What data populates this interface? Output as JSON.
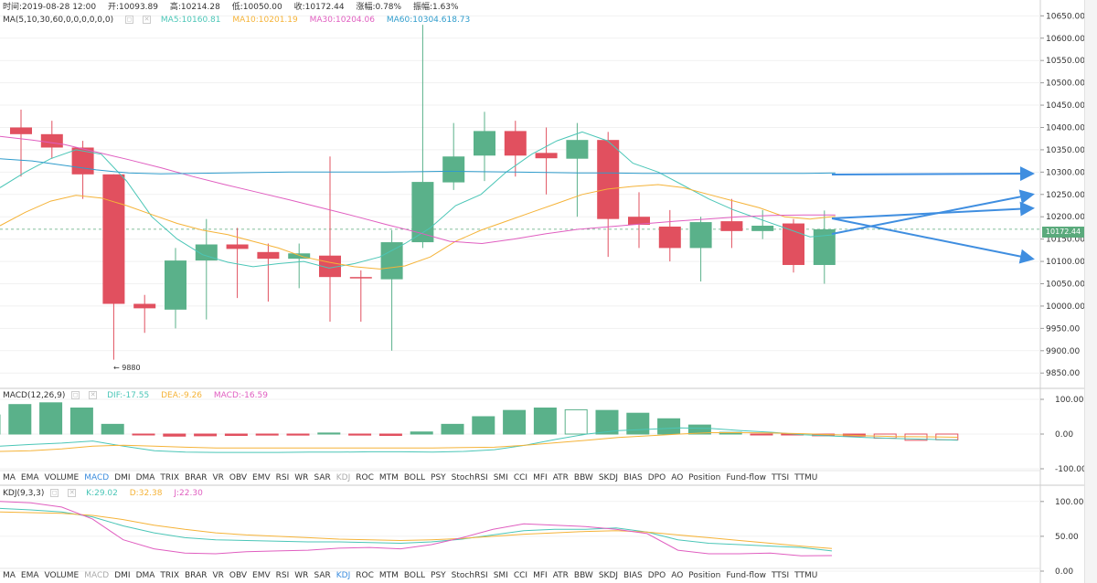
{
  "header": {
    "time_label": "时间:2019-08-28 12:00",
    "open_label": "开:10093.89",
    "high_label": "高:10214.28",
    "low_label": "低:10050.00",
    "close_label": "收:10172.44",
    "change_label": "涨幅:0.78%",
    "amplitude_label": "振幅:1.63%"
  },
  "ma_legend": {
    "title": "MA(5,10,30,60,0,0,0,0,0,0)",
    "ma5": "MA5:10160.81",
    "ma10": "MA10:10201.19",
    "ma30": "MA30:10204.06",
    "ma60": "MA60:10304.",
    "ma60_tail": "618.73"
  },
  "colors": {
    "up": "#5ab18a",
    "down": "#e1505f",
    "ma5": "#4bc6b7",
    "ma10": "#f5b338",
    "ma30": "#e05ec0",
    "ma60": "#2f9ccc",
    "arrow": "#3f8ee0",
    "dif": "#4bc6b7",
    "dea": "#f5b338",
    "macd": "#e05ec0",
    "tab_active": "#3c8dde"
  },
  "price_tag": "10172.44",
  "low_marker": "← 9880",
  "macd_legend": {
    "title": "MACD(12,26,9)",
    "dif": "DIF:-17.55",
    "dea": "DEA:-9.26",
    "macd": "MACD:-16.59"
  },
  "kdj_legend": {
    "title": "KDJ(9,3,3)",
    "k": "K:29.02",
    "d": "D:32.38",
    "j": "J:22.30"
  },
  "indicator_tabs": [
    "MA",
    "EMA",
    "VOLUME",
    "MACD",
    "DMI",
    "DMA",
    "TRIX",
    "BRAR",
    "VR",
    "OBV",
    "EMV",
    "RSI",
    "WR",
    "SAR",
    "KDJ",
    "ROC",
    "MTM",
    "BOLL",
    "PSY",
    "StochRSI",
    "SMI",
    "CCI",
    "MFI",
    "ATR",
    "BBW",
    "SKDJ",
    "BIAS",
    "DPO",
    "AO",
    "Position",
    "Fund-flow",
    "TTSI",
    "TTMU"
  ],
  "chart_data": [
    {
      "type": "candlestick",
      "name": "main",
      "y_ticks": [
        "10650.00",
        "10600.00",
        "10550.00",
        "10500.00",
        "10450.00",
        "10400.00",
        "10350.00",
        "10300.00",
        "10250.00",
        "10200.00",
        "10150.00",
        "10100.00",
        "10050.00",
        "10000.00",
        "9950.00",
        "9900.00",
        "9850.00"
      ],
      "ylim": [
        9830,
        10665
      ],
      "candles": [
        {
          "o": 10400,
          "h": 10440,
          "l": 10290,
          "c": 10385
        },
        {
          "o": 10385,
          "h": 10415,
          "l": 10330,
          "c": 10355
        },
        {
          "o": 10355,
          "h": 10370,
          "l": 10240,
          "c": 10295
        },
        {
          "o": 10295,
          "h": 10295,
          "l": 9880,
          "c": 10005
        },
        {
          "o": 10005,
          "h": 10025,
          "l": 9940,
          "c": 9995
        },
        {
          "o": 9992,
          "h": 10130,
          "l": 9950,
          "c": 10102
        },
        {
          "o": 10102,
          "h": 10195,
          "l": 9970,
          "c": 10138
        },
        {
          "o": 10138,
          "h": 10175,
          "l": 10018,
          "c": 10128
        },
        {
          "o": 10121,
          "h": 10140,
          "l": 10010,
          "c": 10106
        },
        {
          "o": 10106,
          "h": 10140,
          "l": 10040,
          "c": 10118
        },
        {
          "o": 10113,
          "h": 10335,
          "l": 9965,
          "c": 10065
        },
        {
          "o": 10065,
          "h": 10080,
          "l": 9965,
          "c": 10062
        },
        {
          "o": 10060,
          "h": 10170,
          "l": 9900,
          "c": 10143
        },
        {
          "o": 10143,
          "h": 10630,
          "l": 10130,
          "c": 10278
        },
        {
          "o": 10277,
          "h": 10410,
          "l": 10260,
          "c": 10335
        },
        {
          "o": 10337,
          "h": 10435,
          "l": 10280,
          "c": 10392
        },
        {
          "o": 10392,
          "h": 10415,
          "l": 10290,
          "c": 10337
        },
        {
          "o": 10343,
          "h": 10400,
          "l": 10250,
          "c": 10331
        },
        {
          "o": 10330,
          "h": 10410,
          "l": 10200,
          "c": 10372
        },
        {
          "o": 10372,
          "h": 10390,
          "l": 10110,
          "c": 10195
        },
        {
          "o": 10200,
          "h": 10255,
          "l": 10130,
          "c": 10182
        },
        {
          "o": 10178,
          "h": 10215,
          "l": 10100,
          "c": 10130
        },
        {
          "o": 10130,
          "h": 10200,
          "l": 10055,
          "c": 10188
        },
        {
          "o": 10190,
          "h": 10240,
          "l": 10130,
          "c": 10168
        },
        {
          "o": 10168,
          "h": 10215,
          "l": 10150,
          "c": 10180
        },
        {
          "o": 10185,
          "h": 10195,
          "l": 10075,
          "c": 10092
        },
        {
          "o": 10092,
          "h": 10214,
          "l": 10050,
          "c": 10172
        }
      ],
      "ma_series": [
        {
          "name": "MA5",
          "values": [
            10265,
            10300,
            10330,
            10350,
            10340,
            10280,
            10200,
            10150,
            10115,
            10098,
            10088,
            10095,
            10100,
            10085,
            10095,
            10110,
            10140,
            10175,
            10225,
            10250,
            10300,
            10340,
            10370,
            10390,
            10370,
            10320,
            10300,
            10270,
            10240,
            10215,
            10195,
            10175,
            10155,
            10160
          ]
        },
        {
          "name": "MA10",
          "values": [
            10180,
            10210,
            10235,
            10248,
            10242,
            10225,
            10205,
            10185,
            10170,
            10160,
            10145,
            10130,
            10110,
            10098,
            10088,
            10083,
            10090,
            10110,
            10145,
            10170,
            10190,
            10210,
            10230,
            10250,
            10262,
            10268,
            10272,
            10265,
            10250,
            10235,
            10220,
            10200,
            10195,
            10201
          ]
        },
        {
          "name": "MA30",
          "values": [
            10380,
            10372,
            10362,
            10345,
            10328,
            10310,
            10290,
            10272,
            10255,
            10238,
            10220,
            10202,
            10183,
            10165,
            10145,
            10140,
            10150,
            10162,
            10172,
            10178,
            10184,
            10190,
            10195,
            10200,
            10203,
            10204,
            10204
          ]
        },
        {
          "name": "MA60",
          "values": [
            10330,
            10325,
            10315,
            10305,
            10298,
            10296,
            10297,
            10298,
            10299,
            10300,
            10300,
            10300,
            10300,
            10301,
            10302,
            10301,
            10300,
            10299,
            10298,
            10298,
            10297,
            10297,
            10297,
            10297,
            10297,
            10297,
            10298
          ]
        }
      ]
    },
    {
      "type": "bar",
      "name": "MACD",
      "y_ticks": [
        "100.00",
        "0.00",
        "-100.00"
      ],
      "ylim": [
        -100,
        100
      ],
      "histogram": [
        55,
        85,
        90,
        75,
        28,
        -2,
        -6,
        -5,
        -4,
        -3,
        -3,
        3,
        -3,
        -4,
        6,
        28,
        50,
        68,
        75,
        70,
        68,
        60,
        44,
        26,
        5,
        -1,
        -2,
        -5,
        -6,
        -12,
        -18,
        -16.59
      ],
      "dif": [
        -35,
        -30,
        -26,
        -20,
        -35,
        -48,
        -52,
        -53,
        -53,
        -53,
        -52,
        -52,
        -51,
        -51,
        -52,
        -50,
        -45,
        -32,
        -15,
        0,
        10,
        14,
        18,
        16,
        10,
        5,
        -2,
        -6,
        -10,
        -13,
        -15,
        -17.55
      ],
      "dea": [
        -50,
        -48,
        -43,
        -35,
        -32,
        -35,
        -38,
        -40,
        -40,
        -40,
        -40,
        -40,
        -40,
        -40,
        -40,
        -39,
        -38,
        -32,
        -25,
        -18,
        -10,
        -5,
        0,
        4,
        4,
        3,
        1,
        -2,
        -5,
        -7,
        -8,
        -9.26
      ]
    },
    {
      "type": "line",
      "name": "KDJ",
      "y_ticks": [
        "100.00",
        "50.00",
        "0.00"
      ],
      "ylim": [
        0,
        105
      ],
      "k": [
        90,
        88,
        85,
        78,
        65,
        55,
        48,
        45,
        44,
        43,
        42,
        42,
        41,
        40,
        42,
        46,
        52,
        58,
        60,
        60,
        62,
        56,
        45,
        40,
        38,
        36,
        34,
        29.02
      ],
      "d": [
        85,
        84,
        83,
        80,
        74,
        66,
        60,
        55,
        52,
        50,
        48,
        46,
        45,
        44,
        45,
        47,
        50,
        53,
        55,
        57,
        58,
        56,
        52,
        48,
        44,
        40,
        36,
        32.38
      ],
      "j": [
        100,
        98,
        92,
        75,
        45,
        32,
        26,
        25,
        28,
        29,
        30,
        33,
        34,
        32,
        38,
        48,
        60,
        68,
        66,
        64,
        60,
        54,
        30,
        25,
        25,
        26,
        22,
        22.3
      ]
    }
  ]
}
